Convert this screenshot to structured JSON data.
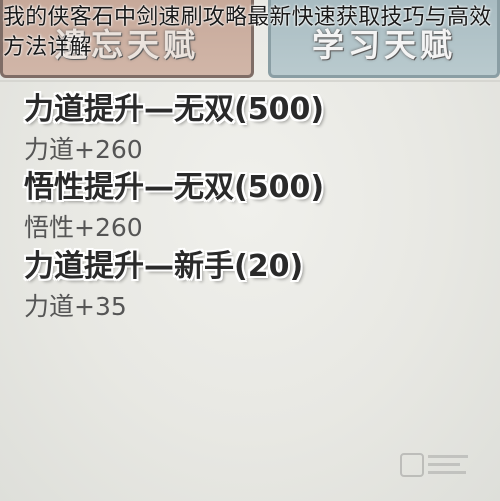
{
  "caption": "我的侠客石中剑速刷攻略最新快速获取技巧与高效方法详解",
  "tabs": {
    "forget_label": "遗忘天赋",
    "learn_label": "学习天赋"
  },
  "talents": [
    {
      "name": "力道提升—无双(500)",
      "effect": "力道+260"
    },
    {
      "name": "悟性提升—无双(500)",
      "effect": "悟性+260"
    },
    {
      "name": "力道提升—新手(20)",
      "effect": "力道+35"
    }
  ],
  "colors": {
    "forget_tab": "#c7a99a",
    "learn_tab": "#a9bcc2",
    "background": "#e9e9e5"
  }
}
